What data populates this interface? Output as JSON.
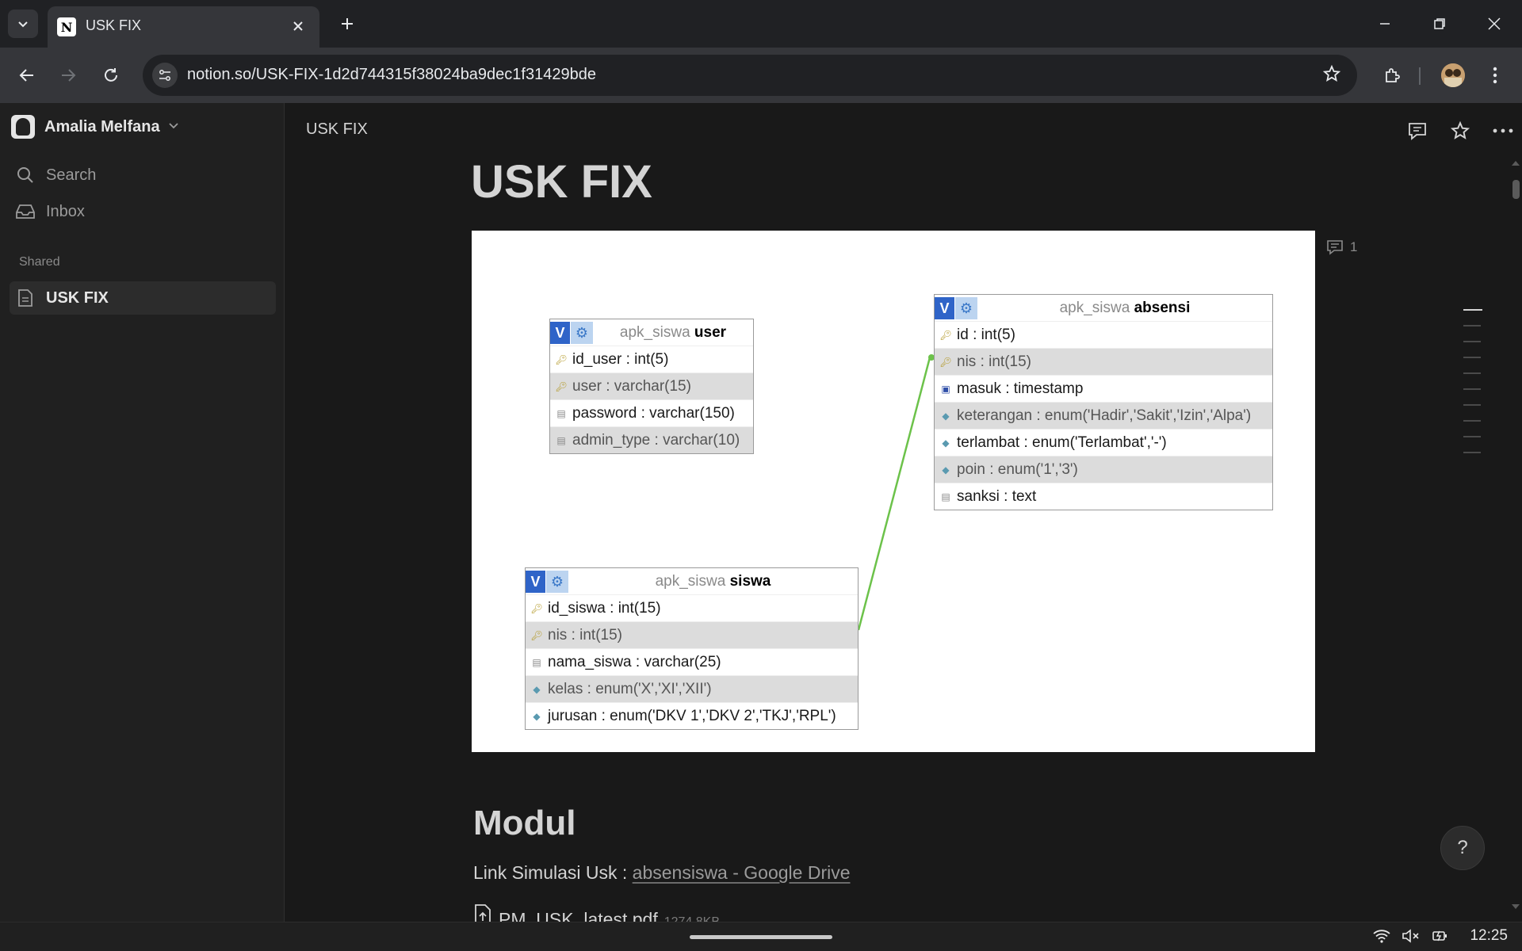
{
  "browser": {
    "tab_title": "USK FIX",
    "tab_favicon": "N",
    "url": "notion.so/USK-FIX-1d2d744315f38024ba9dec1f31429bde"
  },
  "sidebar": {
    "workspace_name": "Amalia Melfana",
    "search_label": "Search",
    "inbox_label": "Inbox",
    "section_shared": "Shared",
    "shared_items": [
      {
        "label": "USK FIX"
      }
    ]
  },
  "page": {
    "breadcrumb": "USK FIX",
    "title": "USK FIX",
    "comment_count": "1",
    "section_heading": "Modul",
    "link_prefix": "Link Simulasi Usk : ",
    "link_text": "absensiswa - Google Drive",
    "file_name": "PM_USK_latest.pdf",
    "file_size": "1274.8KB",
    "help_label": "?"
  },
  "erd": {
    "user": {
      "db": "apk_siswa",
      "name": "user",
      "rows": [
        {
          "text": "id_user : int(5)",
          "icon": "key"
        },
        {
          "text": "user : varchar(15)",
          "icon": "key"
        },
        {
          "text": "password : varchar(150)",
          "icon": "doc"
        },
        {
          "text": "admin_type : varchar(10)",
          "icon": "doc"
        }
      ]
    },
    "absensi": {
      "db": "apk_siswa",
      "name": "absensi",
      "rows": [
        {
          "text": "id : int(5)",
          "icon": "key"
        },
        {
          "text": "nis : int(15)",
          "icon": "key"
        },
        {
          "text": "masuk : timestamp",
          "icon": "cal"
        },
        {
          "text": "keterangan : enum('Hadir','Sakit','Izin','Alpa')",
          "icon": "dia"
        },
        {
          "text": "terlambat : enum('Terlambat','-')",
          "icon": "dia"
        },
        {
          "text": "poin : enum('1','3')",
          "icon": "dia"
        },
        {
          "text": "sanksi : text",
          "icon": "doc"
        }
      ]
    },
    "siswa": {
      "db": "apk_siswa",
      "name": "siswa",
      "rows": [
        {
          "text": "id_siswa : int(15)",
          "icon": "key"
        },
        {
          "text": "nis : int(15)",
          "icon": "key"
        },
        {
          "text": "nama_siswa : varchar(25)",
          "icon": "doc"
        },
        {
          "text": "kelas : enum('X','XI','XII')",
          "icon": "dia"
        },
        {
          "text": "jurusan : enum('DKV 1','DKV 2','TKJ','RPL')",
          "icon": "dia"
        }
      ]
    }
  },
  "taskbar": {
    "clock": "12:25"
  },
  "colors": {
    "relation_line": "#6cc24a",
    "erd_header_blue": "#2f64c8"
  }
}
